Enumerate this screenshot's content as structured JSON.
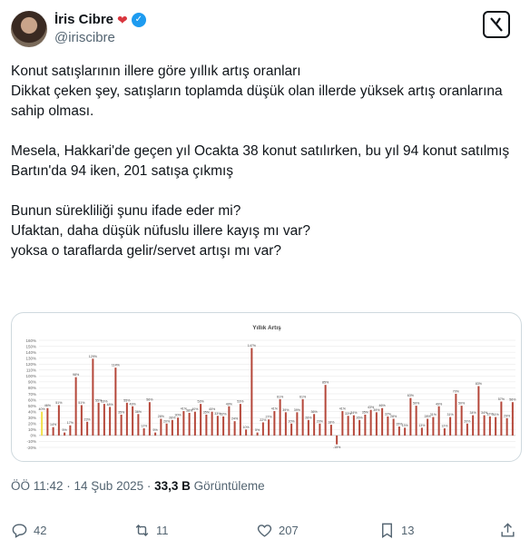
{
  "author": {
    "name": "İris Cibre",
    "handle": "@iriscibre",
    "bird_icon": "red-bird-icon",
    "verified_icon": "verified-badge-icon"
  },
  "header": {
    "grok_label": "⁄"
  },
  "tweet": {
    "text": "Konut satışlarının illere göre yıllık artış oranları\nDikkat çeken şey, satışların toplamda düşük olan illerde yüksek artış oranlarına sahip olması.\n\nMesela, Hakkari'de geçen yıl Ocakta 38 konut satılırken, bu yıl 94 konut satılmış\nBartın'da 94 iken, 201 satışa çıkmış\n\nBunun sürekliliği şunu ifade eder mi?\nUfaktan, daha düşük nüfuslu illere kayış mı var?\nyoksa o taraflarda gelir/servet artışı mı var?"
  },
  "meta": {
    "time": "ÖÖ 11:42 · 14 Şub 2025 · ",
    "views": "33,3 B",
    "views_label": " Görüntüleme"
  },
  "actions": {
    "replies": "42",
    "reposts": "11",
    "likes": "207",
    "bookmarks": "13"
  },
  "colors": {
    "bar": "#b5473a",
    "highlight": "#f2e04a",
    "accent": "#1d9bf0"
  },
  "chart_data": {
    "type": "bar",
    "title": "Yıllık Artış",
    "ylim": [
      -20,
      160
    ],
    "yticks": [
      "-20%",
      "-10%",
      "0%",
      "10%",
      "20%",
      "30%",
      "40%",
      "50%",
      "60%",
      "70%",
      "80%",
      "90%",
      "100%",
      "110%",
      "120%",
      "130%",
      "140%",
      "150%",
      "160%"
    ],
    "grid": true,
    "values": [
      40,
      46,
      14,
      51,
      5,
      17,
      98,
      51,
      23,
      129,
      55,
      53,
      48,
      114,
      35,
      55,
      49,
      36,
      12,
      56,
      5,
      28,
      20,
      26,
      30,
      41,
      38,
      40,
      53,
      35,
      40,
      33,
      32,
      49,
      24,
      53,
      10,
      147,
      5,
      22,
      27,
      41,
      61,
      39,
      20,
      39,
      61,
      26,
      36,
      20,
      85,
      18,
      -15,
      41,
      33,
      34,
      26,
      35,
      43,
      39,
      46,
      32,
      28,
      15,
      13,
      63,
      50,
      13,
      28,
      31,
      49,
      12,
      31,
      70,
      50,
      20,
      34,
      83,
      34,
      32,
      31,
      57,
      29,
      56
    ]
  }
}
